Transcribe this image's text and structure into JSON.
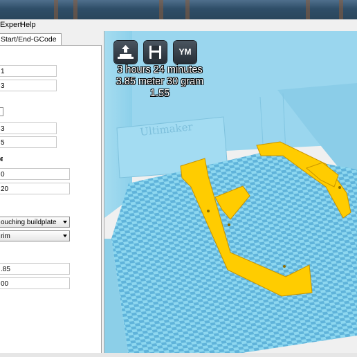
{
  "menu": {
    "items": [
      "Expert",
      "Help"
    ]
  },
  "tabs": {
    "active_label": "Start/End-GCode"
  },
  "settings": {
    "fields": [
      "1",
      "3",
      "3",
      "5",
      "0",
      "20"
    ],
    "platform_adhesion": {
      "support_type": "ouching buildplate",
      "adhesion_type": "rim"
    },
    "filament": {
      "diameter": ".85",
      "flow": "00"
    }
  },
  "toolbar": {
    "load": "load-icon",
    "save": "save-icon",
    "ym_label": "YM"
  },
  "print_info": {
    "time": "3 hours 24 minutes",
    "material": "3.85 meter 30 gram",
    "cost": "1.55"
  },
  "scene": {
    "platform_logo": "Ultimaker",
    "model_color": "#ffcc00",
    "grid_light": "#8ed8f0",
    "grid_dark": "#5fb3da"
  }
}
